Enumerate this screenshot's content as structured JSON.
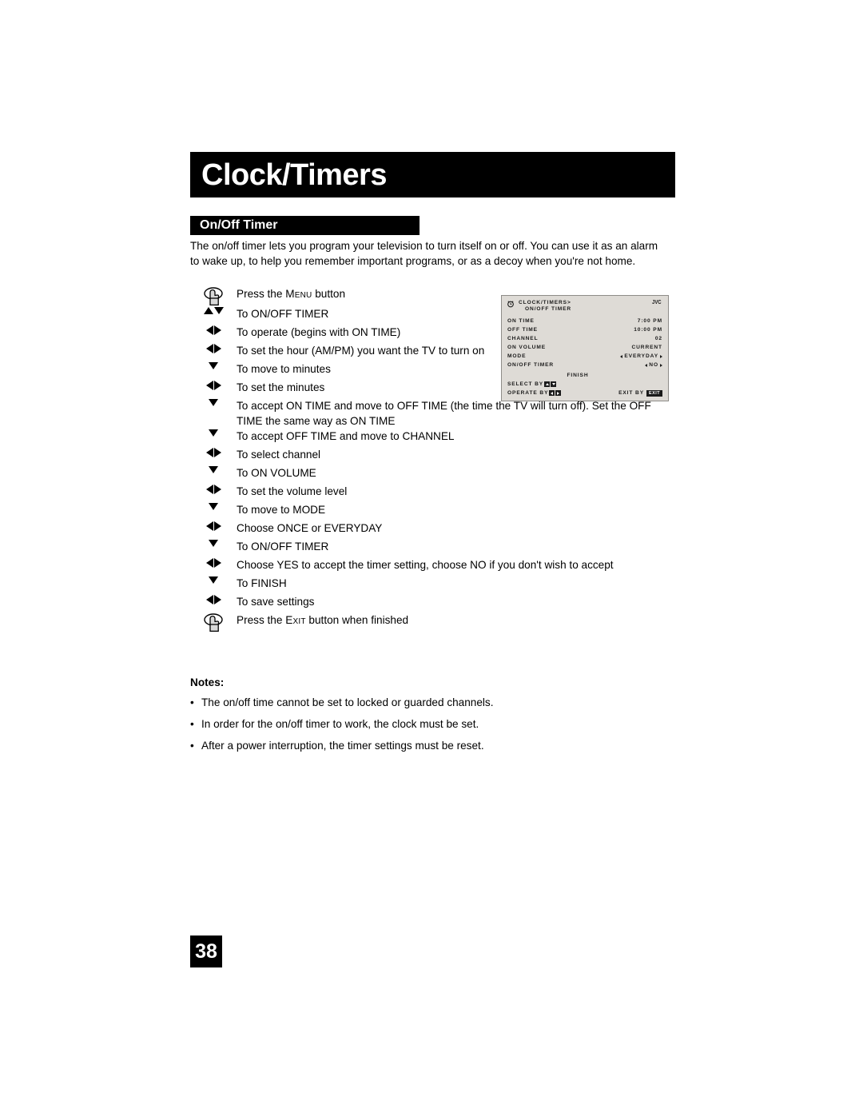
{
  "document": {
    "chapter_title": "Clock/Timers",
    "section_title": "On/Off Timer",
    "intro": "The on/off timer lets you program your television to turn itself on or off. You can use it as an alarm to wake up, to help you remember important programs, or as a decoy when you're not home.",
    "page_number": "38"
  },
  "steps": [
    {
      "icon": "hand-press-icon",
      "text_pre": "Press the ",
      "text_sc": "Menu",
      "text_post": " button"
    },
    {
      "icon": "up-down-arrows-icon",
      "text": "To ON/OFF TIMER"
    },
    {
      "icon": "left-right-arrows-icon",
      "text": "To operate (begins with ON TIME)"
    },
    {
      "icon": "left-right-arrows-icon",
      "text": "To set the hour (AM/PM) you want the TV to turn on"
    },
    {
      "icon": "down-arrow-icon",
      "text": "To move to minutes"
    },
    {
      "icon": "left-right-arrows-icon",
      "text": "To set the minutes"
    },
    {
      "icon": "down-arrow-icon",
      "text": "To accept ON TIME and move to OFF TIME (the time the TV will turn off). Set the OFF TIME the same way as ON TIME"
    },
    {
      "icon": "down-arrow-icon",
      "text": "To accept OFF TIME and move to CHANNEL"
    },
    {
      "icon": "left-right-arrows-icon",
      "text": "To select channel"
    },
    {
      "icon": "down-arrow-icon",
      "text": "To ON VOLUME"
    },
    {
      "icon": "left-right-arrows-icon",
      "text": "To set the volume level"
    },
    {
      "icon": "down-arrow-icon",
      "text": "To move to MODE"
    },
    {
      "icon": "left-right-arrows-icon",
      "text": "Choose ONCE or EVERYDAY"
    },
    {
      "icon": "down-arrow-icon",
      "text": "To ON/OFF TIMER"
    },
    {
      "icon": "left-right-arrows-icon",
      "text": "Choose YES to accept the timer setting, choose NO if you don't wish to accept"
    },
    {
      "icon": "down-arrow-icon",
      "text": "To FINISH"
    },
    {
      "icon": "left-right-arrows-icon",
      "text": "To save settings"
    },
    {
      "icon": "hand-press-icon",
      "text_pre": "Press the ",
      "text_sc": "Exit",
      "text_post": " button when finished"
    }
  ],
  "osd": {
    "clock_icon": "alarm-clock-icon",
    "breadcrumb": "CLOCK/TIMERS>",
    "submenu": "ON/OFF TIMER",
    "brand": "JVC",
    "rows": [
      {
        "label": "ON TIME",
        "value": "7:00 PM",
        "arrows": false
      },
      {
        "label": "OFF TIME",
        "value": "10:00 PM",
        "arrows": false
      },
      {
        "label": "CHANNEL",
        "value": "02",
        "arrows": false
      },
      {
        "label": "ON VOLUME",
        "value": "CURRENT",
        "arrows": false
      },
      {
        "label": "MODE",
        "value": "EVERYDAY",
        "arrows": true
      },
      {
        "label": "ON/OFF TIMER",
        "value": "NO",
        "arrows": true
      }
    ],
    "finish": "FINISH",
    "select_label": "SELECT  BY",
    "operate_label": "OPERATE BY",
    "exit_label": "EXIT BY",
    "exit_badge": "EXIT"
  },
  "notes": {
    "title": "Notes:",
    "items": [
      "The on/off time cannot be set to locked or guarded channels.",
      "In order for the on/off timer to work, the clock must be set.",
      "After a power interruption, the timer settings must be reset."
    ]
  },
  "colors": {
    "banner_bg": "#000000",
    "banner_text": "#ffffff",
    "osd_bg": "#dedbd6",
    "osd_border": "#8e8c88",
    "page_bg": "#ffffff"
  }
}
